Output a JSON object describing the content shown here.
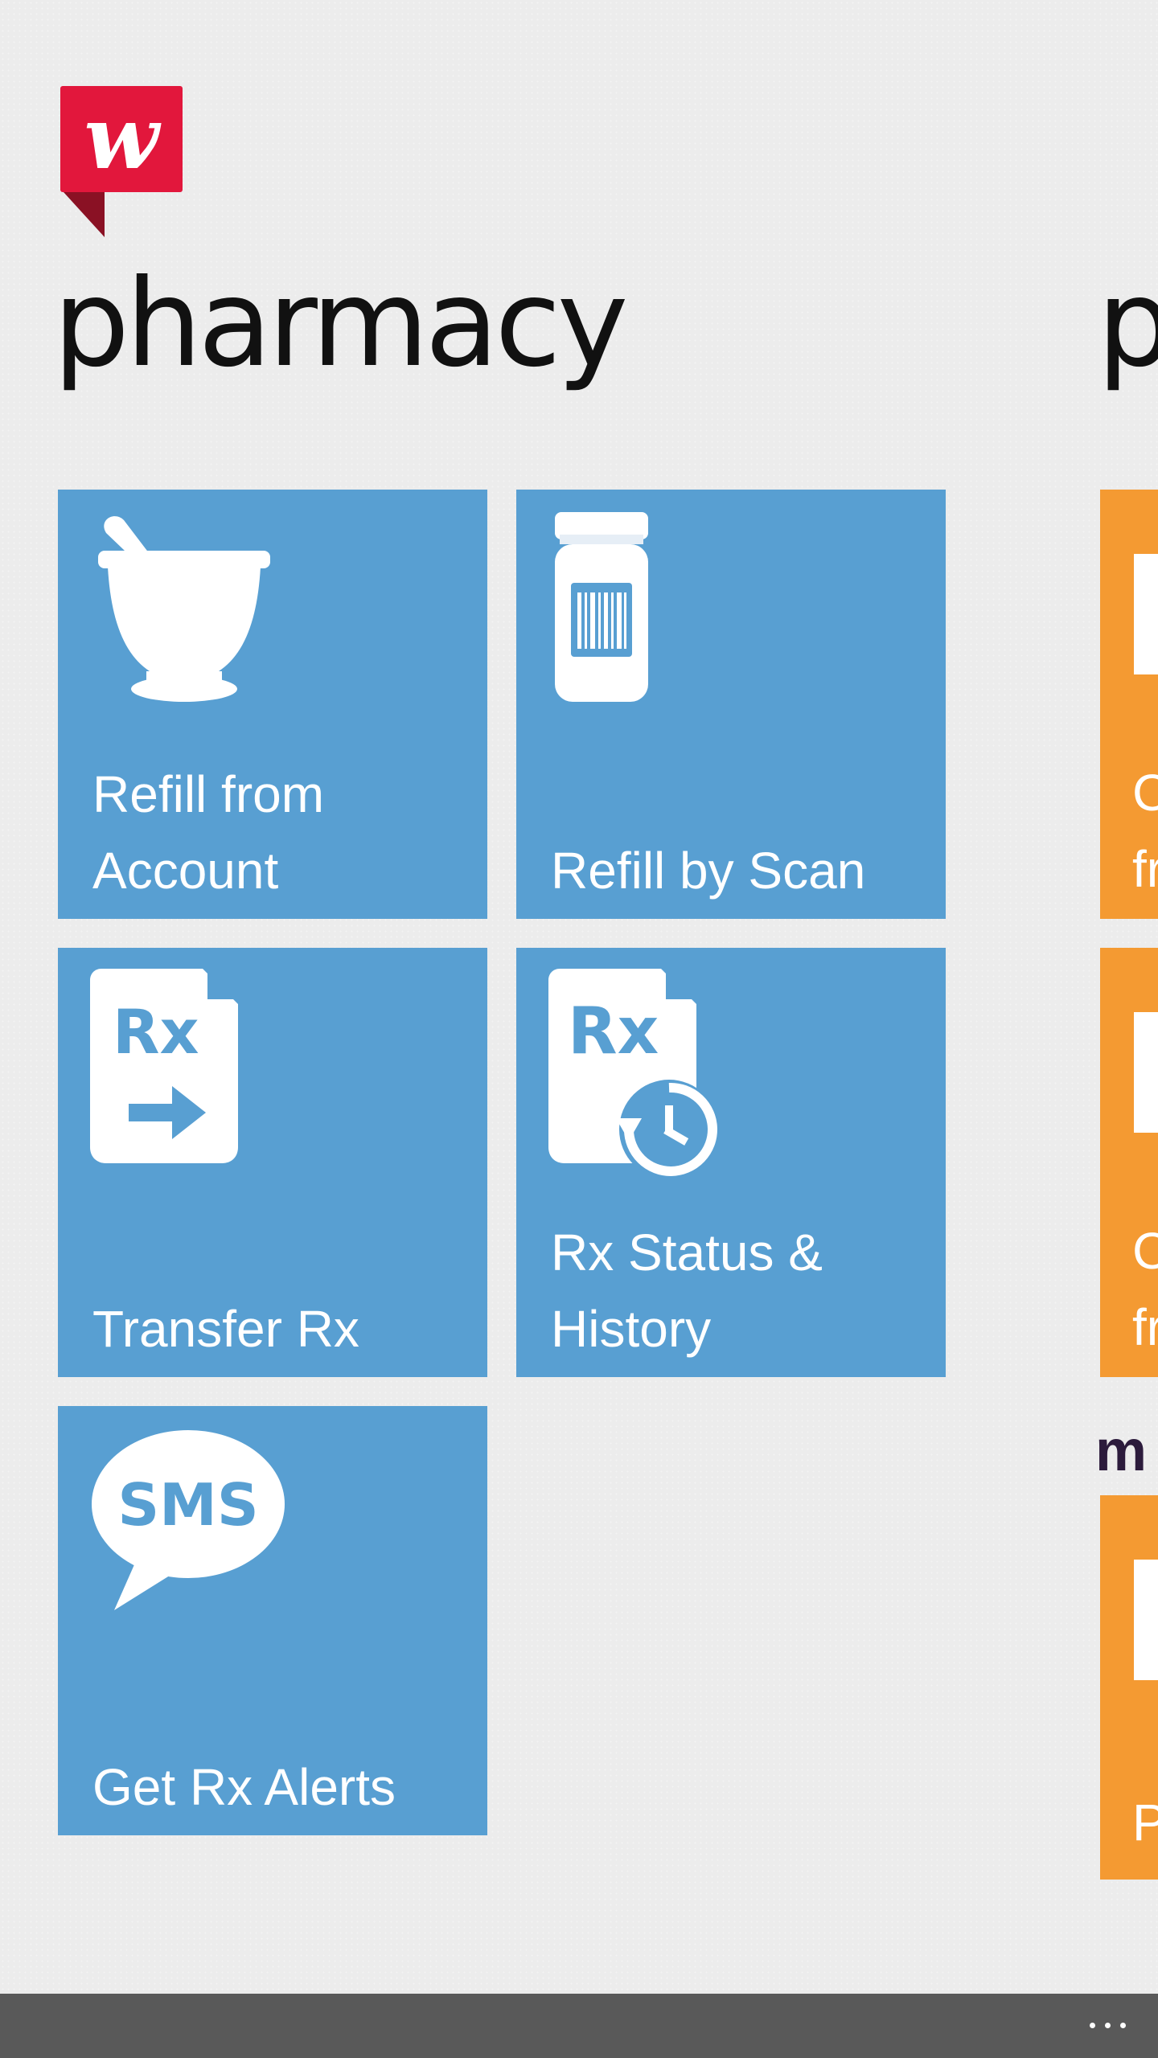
{
  "brand": {
    "logo_letter": "w",
    "logo_color": "#e2173c",
    "logo_fold_color": "#8a1124"
  },
  "page": {
    "title": "pharmacy",
    "next_section_title": "p"
  },
  "tiles": [
    {
      "label": "Refill from\nAccount",
      "icon": "mortar-pestle-icon"
    },
    {
      "label": "Refill by Scan",
      "icon": "pill-bottle-barcode-icon"
    },
    {
      "label": "Transfer Rx",
      "icon": "rx-transfer-icon",
      "icon_text": "Rx"
    },
    {
      "label": "Rx Status &\nHistory",
      "icon": "rx-history-icon",
      "icon_text": "Rx"
    },
    {
      "label": "Get Rx Alerts",
      "icon": "sms-bubble-icon",
      "icon_text": "SMS"
    }
  ],
  "next_panel": {
    "tiles": [
      {
        "label": "C\nfr"
      },
      {
        "label": "C\nfr"
      },
      {
        "label": "P"
      }
    ],
    "section_label": "m"
  },
  "app_bar": {
    "more_label": "more",
    "background": "#595959"
  },
  "colors": {
    "tile_blue": "#589fd2",
    "tile_orange": "#f49a32",
    "background": "#ececec"
  }
}
